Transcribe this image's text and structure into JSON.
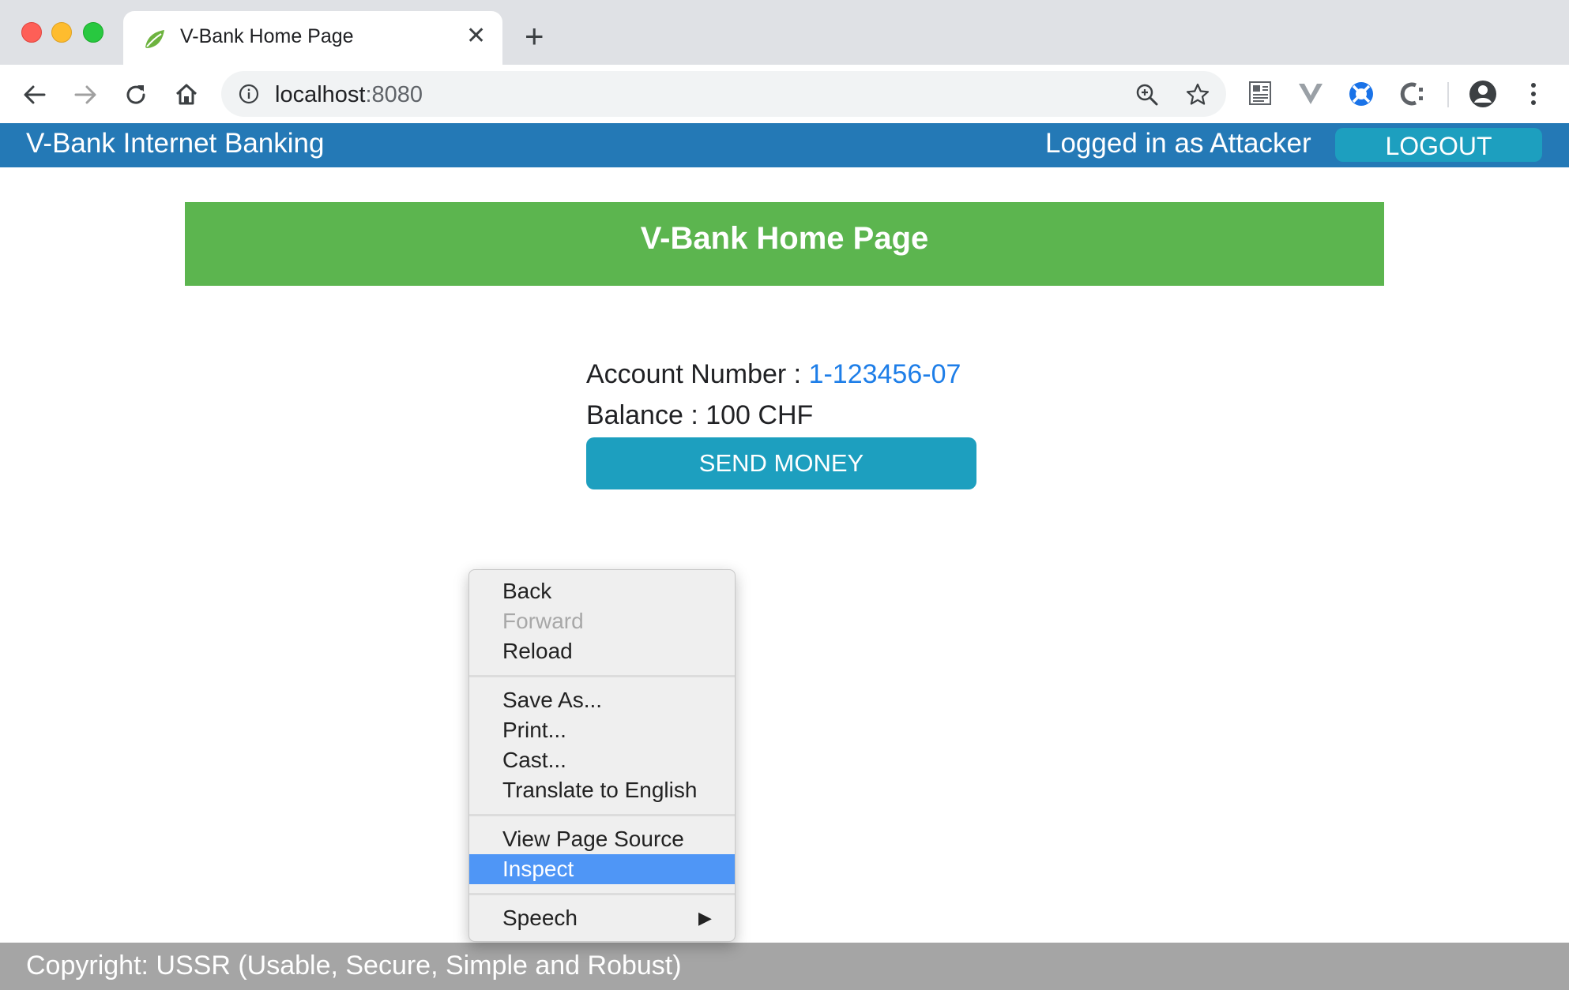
{
  "browser": {
    "tab_title": "V-Bank Home Page",
    "tab_close": "✕",
    "new_tab": "+",
    "url_host": "localhost",
    "url_port": ":8080"
  },
  "header": {
    "brand": "V-Bank Internet Banking",
    "logged_in": "Logged in as Attacker",
    "logout_label": "LOGOUT"
  },
  "main": {
    "page_title": "V-Bank Home Page",
    "account_label": "Account Number : ",
    "account_number": "1-123456-07",
    "balance_label": "Balance : ",
    "balance_value": "100 CHF",
    "send_money_label": "SEND MONEY"
  },
  "context_menu": {
    "items": [
      {
        "label": "Back"
      },
      {
        "label": "Forward"
      },
      {
        "label": "Reload"
      },
      {
        "label": "Save As..."
      },
      {
        "label": "Print..."
      },
      {
        "label": "Cast..."
      },
      {
        "label": "Translate to English"
      },
      {
        "label": "View Page Source"
      },
      {
        "label": "Inspect"
      },
      {
        "label": "Speech"
      }
    ],
    "submenu_arrow": "▶"
  },
  "footer": {
    "copyright": "Copyright: USSR (Usable, Secure, Simple and Robust)"
  },
  "colors": {
    "header_bg": "#2479b6",
    "hero_bg": "#5cb54f",
    "button_bg": "#1d9fbf",
    "link": "#1e7ee8",
    "menu_highlight": "#4f96f6",
    "footer_bg": "#a5a5a5"
  }
}
